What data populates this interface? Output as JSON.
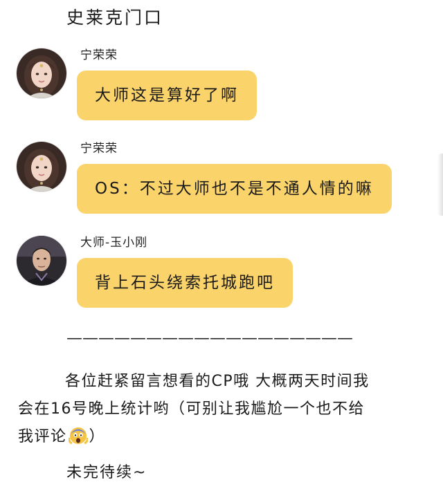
{
  "heading": "史莱克门口",
  "messages": [
    {
      "sender": "宁荣荣",
      "text": "大师这是算好了啊",
      "avatar": "female-character-avatar"
    },
    {
      "sender": "宁荣荣",
      "text": "OS：不过大师也不是不通人情的嘛",
      "avatar": "female-character-avatar"
    },
    {
      "sender": "大师-玉小刚",
      "text": "背上石头绕索托城跑吧",
      "avatar": "male-character-avatar"
    }
  ],
  "divider": "——————————————————",
  "paragraph_line_1": "各位赶紧留言想看的CP哦 大概两天时间我",
  "paragraph_line_2": "会在16号晚上统计哟（可别让我尴尬一个也不给",
  "paragraph_line_3_before": "我评论",
  "paragraph_line_3_after": "）",
  "emoji_name": "screaming-face-emoji",
  "to_be_continued": "未完待续~",
  "colors": {
    "bubble": "#fbd36b",
    "text": "#1a1a1a",
    "background": "#ffffff"
  }
}
